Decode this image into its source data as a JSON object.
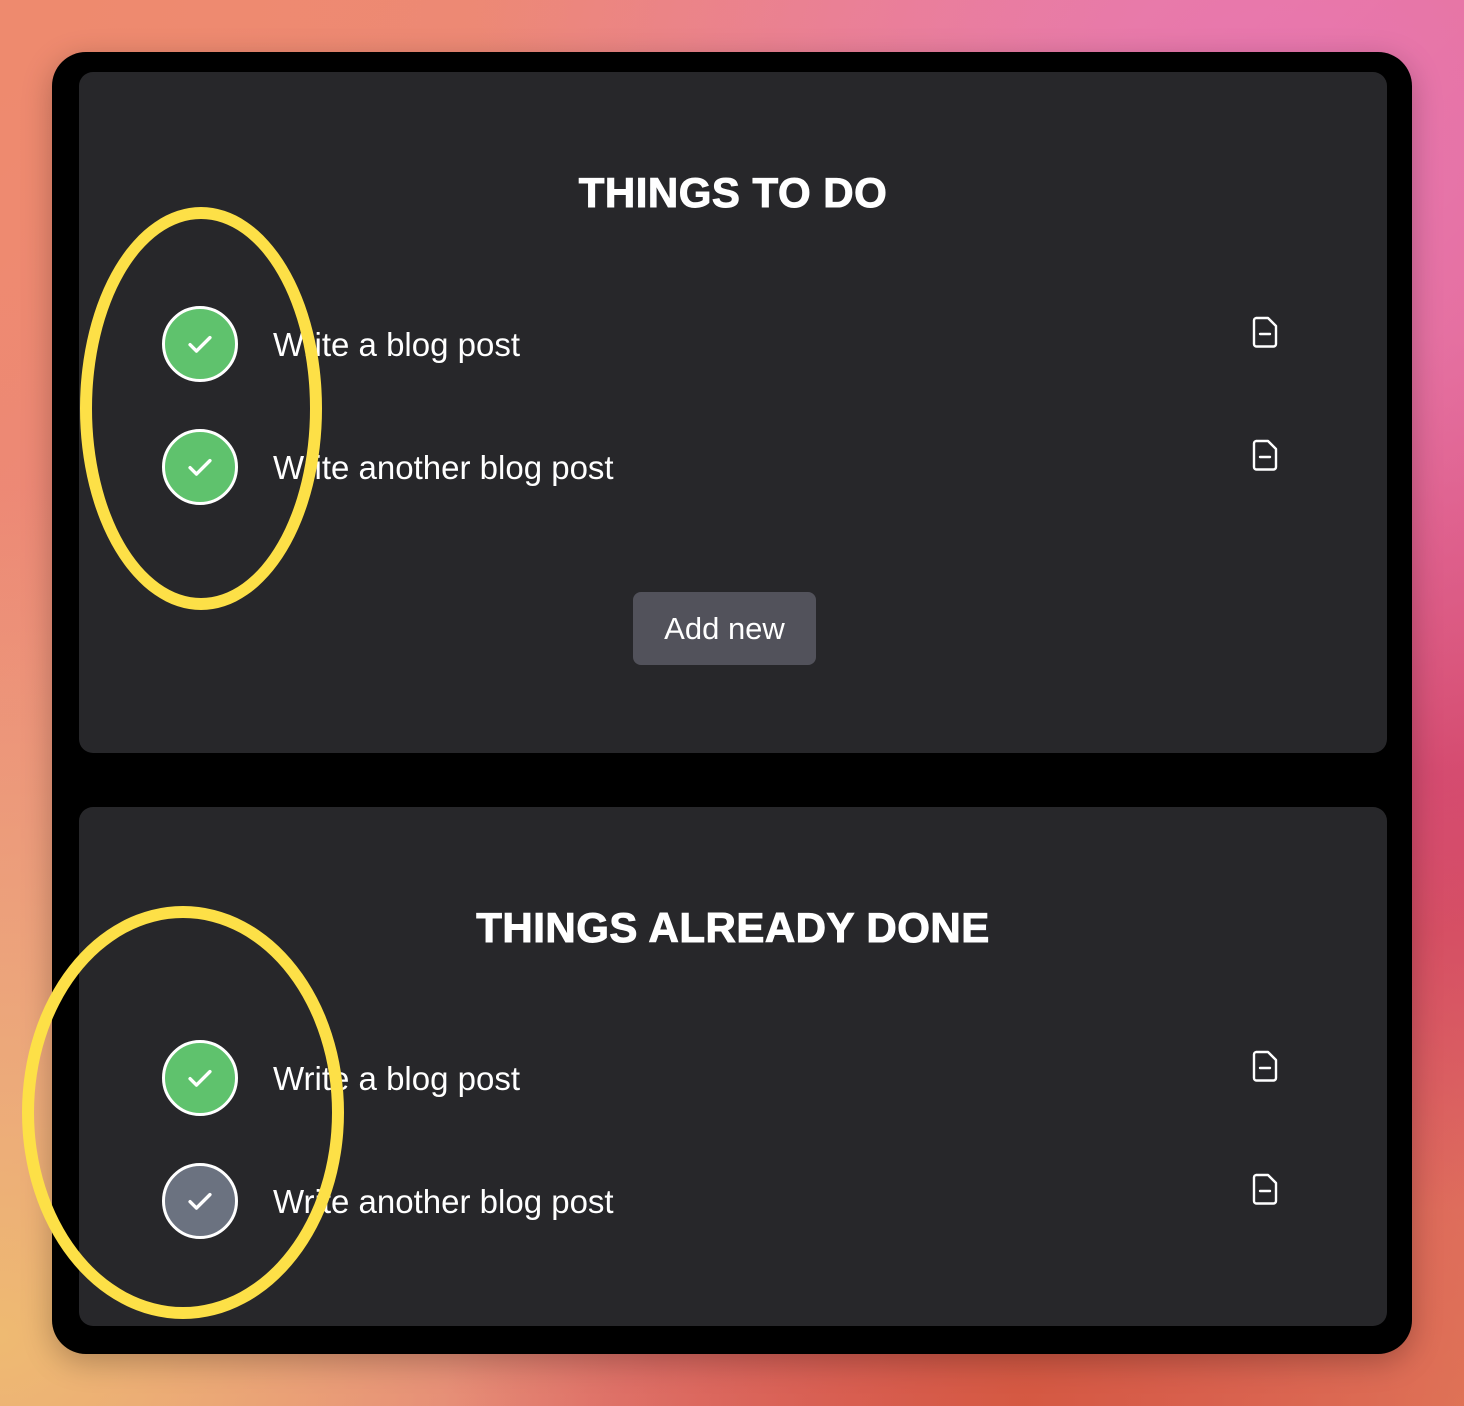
{
  "colors": {
    "done_check": "#5fc26d",
    "pending_check": "#6b7280",
    "highlight": "#fde047",
    "panel_bg": "#27272a",
    "button_bg": "#52525b"
  },
  "todo": {
    "title": "THINGS TO DO",
    "items": [
      {
        "label": "Write a blog post",
        "checked": true,
        "icon": "check-icon",
        "action_icon": "document-minus-icon"
      },
      {
        "label": "Write another blog post",
        "checked": true,
        "icon": "check-icon",
        "action_icon": "document-minus-icon"
      }
    ],
    "add_button_label": "Add new"
  },
  "done": {
    "title": "THINGS ALREADY DONE",
    "items": [
      {
        "label": "Write a blog post",
        "checked": true,
        "icon": "check-icon",
        "action_icon": "document-minus-icon"
      },
      {
        "label": "Write another blog post",
        "checked": false,
        "icon": "check-icon",
        "action_icon": "document-minus-icon"
      }
    ]
  }
}
